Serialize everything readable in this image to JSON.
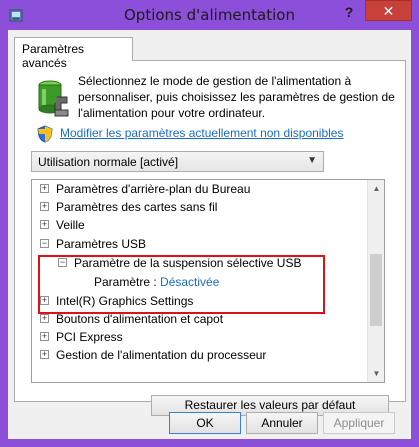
{
  "window": {
    "title": "Options d'alimentation",
    "help_label": "?",
    "close_label": "✕"
  },
  "tab": {
    "label": "Paramètres avancés"
  },
  "description": "Sélectionnez le mode de gestion de l'alimentation à personnaliser, puis choisissez les paramètres de gestion de l'alimentation pour votre ordinateur.",
  "link": {
    "label": "Modifier les paramètres actuellement non disponibles"
  },
  "plan_select": {
    "value": "Utilisation normale [activé]"
  },
  "tree": {
    "items": [
      {
        "label": "Paramètres d'arrière-plan du Bureau",
        "expander": "+"
      },
      {
        "label": "Paramètres des cartes sans fil",
        "expander": "+"
      },
      {
        "label": "Veille",
        "expander": "+"
      },
      {
        "label": "Paramètres USB",
        "expander": "−"
      },
      {
        "label": "Paramètre de la suspension sélective USB",
        "expander": "−"
      },
      {
        "label": "Paramètre :",
        "value": "Désactivée"
      },
      {
        "label": "Intel(R) Graphics Settings",
        "expander": "+"
      },
      {
        "label": "Boutons d'alimentation et capot",
        "expander": "+"
      },
      {
        "label": "PCI Express",
        "expander": "+"
      },
      {
        "label": "Gestion de l'alimentation du processeur",
        "expander": "+"
      }
    ]
  },
  "buttons": {
    "restore": "Restaurer les valeurs par défaut",
    "ok": "OK",
    "cancel": "Annuler",
    "apply": "Appliquer"
  },
  "colors": {
    "window_frame": "#8c4fd9",
    "close_button": "#c7403a",
    "link": "#1a6cc8",
    "highlight_box": "#e0101a"
  },
  "icons": [
    "power-options-icon",
    "battery-plan-icon",
    "uac-shield-icon",
    "dropdown-chevron-icon",
    "expand-icon",
    "collapse-icon",
    "scroll-up-icon",
    "scroll-down-icon"
  ]
}
